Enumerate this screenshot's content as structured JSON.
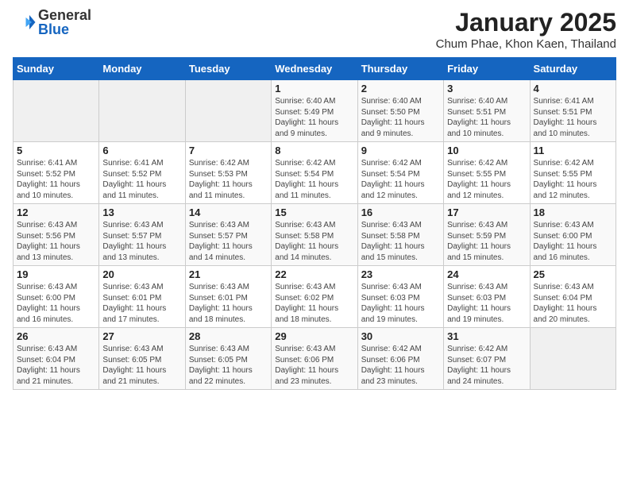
{
  "header": {
    "logo_general": "General",
    "logo_blue": "Blue",
    "title": "January 2025",
    "subtitle": "Chum Phae, Khon Kaen, Thailand"
  },
  "calendar": {
    "days_of_week": [
      "Sunday",
      "Monday",
      "Tuesday",
      "Wednesday",
      "Thursday",
      "Friday",
      "Saturday"
    ],
    "weeks": [
      [
        {
          "day": "",
          "detail": ""
        },
        {
          "day": "",
          "detail": ""
        },
        {
          "day": "",
          "detail": ""
        },
        {
          "day": "1",
          "detail": "Sunrise: 6:40 AM\nSunset: 5:49 PM\nDaylight: 11 hours\nand 9 minutes."
        },
        {
          "day": "2",
          "detail": "Sunrise: 6:40 AM\nSunset: 5:50 PM\nDaylight: 11 hours\nand 9 minutes."
        },
        {
          "day": "3",
          "detail": "Sunrise: 6:40 AM\nSunset: 5:51 PM\nDaylight: 11 hours\nand 10 minutes."
        },
        {
          "day": "4",
          "detail": "Sunrise: 6:41 AM\nSunset: 5:51 PM\nDaylight: 11 hours\nand 10 minutes."
        }
      ],
      [
        {
          "day": "5",
          "detail": "Sunrise: 6:41 AM\nSunset: 5:52 PM\nDaylight: 11 hours\nand 10 minutes."
        },
        {
          "day": "6",
          "detail": "Sunrise: 6:41 AM\nSunset: 5:52 PM\nDaylight: 11 hours\nand 11 minutes."
        },
        {
          "day": "7",
          "detail": "Sunrise: 6:42 AM\nSunset: 5:53 PM\nDaylight: 11 hours\nand 11 minutes."
        },
        {
          "day": "8",
          "detail": "Sunrise: 6:42 AM\nSunset: 5:54 PM\nDaylight: 11 hours\nand 11 minutes."
        },
        {
          "day": "9",
          "detail": "Sunrise: 6:42 AM\nSunset: 5:54 PM\nDaylight: 11 hours\nand 12 minutes."
        },
        {
          "day": "10",
          "detail": "Sunrise: 6:42 AM\nSunset: 5:55 PM\nDaylight: 11 hours\nand 12 minutes."
        },
        {
          "day": "11",
          "detail": "Sunrise: 6:42 AM\nSunset: 5:55 PM\nDaylight: 11 hours\nand 12 minutes."
        }
      ],
      [
        {
          "day": "12",
          "detail": "Sunrise: 6:43 AM\nSunset: 5:56 PM\nDaylight: 11 hours\nand 13 minutes."
        },
        {
          "day": "13",
          "detail": "Sunrise: 6:43 AM\nSunset: 5:57 PM\nDaylight: 11 hours\nand 13 minutes."
        },
        {
          "day": "14",
          "detail": "Sunrise: 6:43 AM\nSunset: 5:57 PM\nDaylight: 11 hours\nand 14 minutes."
        },
        {
          "day": "15",
          "detail": "Sunrise: 6:43 AM\nSunset: 5:58 PM\nDaylight: 11 hours\nand 14 minutes."
        },
        {
          "day": "16",
          "detail": "Sunrise: 6:43 AM\nSunset: 5:58 PM\nDaylight: 11 hours\nand 15 minutes."
        },
        {
          "day": "17",
          "detail": "Sunrise: 6:43 AM\nSunset: 5:59 PM\nDaylight: 11 hours\nand 15 minutes."
        },
        {
          "day": "18",
          "detail": "Sunrise: 6:43 AM\nSunset: 6:00 PM\nDaylight: 11 hours\nand 16 minutes."
        }
      ],
      [
        {
          "day": "19",
          "detail": "Sunrise: 6:43 AM\nSunset: 6:00 PM\nDaylight: 11 hours\nand 16 minutes."
        },
        {
          "day": "20",
          "detail": "Sunrise: 6:43 AM\nSunset: 6:01 PM\nDaylight: 11 hours\nand 17 minutes."
        },
        {
          "day": "21",
          "detail": "Sunrise: 6:43 AM\nSunset: 6:01 PM\nDaylight: 11 hours\nand 18 minutes."
        },
        {
          "day": "22",
          "detail": "Sunrise: 6:43 AM\nSunset: 6:02 PM\nDaylight: 11 hours\nand 18 minutes."
        },
        {
          "day": "23",
          "detail": "Sunrise: 6:43 AM\nSunset: 6:03 PM\nDaylight: 11 hours\nand 19 minutes."
        },
        {
          "day": "24",
          "detail": "Sunrise: 6:43 AM\nSunset: 6:03 PM\nDaylight: 11 hours\nand 19 minutes."
        },
        {
          "day": "25",
          "detail": "Sunrise: 6:43 AM\nSunset: 6:04 PM\nDaylight: 11 hours\nand 20 minutes."
        }
      ],
      [
        {
          "day": "26",
          "detail": "Sunrise: 6:43 AM\nSunset: 6:04 PM\nDaylight: 11 hours\nand 21 minutes."
        },
        {
          "day": "27",
          "detail": "Sunrise: 6:43 AM\nSunset: 6:05 PM\nDaylight: 11 hours\nand 21 minutes."
        },
        {
          "day": "28",
          "detail": "Sunrise: 6:43 AM\nSunset: 6:05 PM\nDaylight: 11 hours\nand 22 minutes."
        },
        {
          "day": "29",
          "detail": "Sunrise: 6:43 AM\nSunset: 6:06 PM\nDaylight: 11 hours\nand 23 minutes."
        },
        {
          "day": "30",
          "detail": "Sunrise: 6:42 AM\nSunset: 6:06 PM\nDaylight: 11 hours\nand 23 minutes."
        },
        {
          "day": "31",
          "detail": "Sunrise: 6:42 AM\nSunset: 6:07 PM\nDaylight: 11 hours\nand 24 minutes."
        },
        {
          "day": "",
          "detail": ""
        }
      ]
    ]
  }
}
